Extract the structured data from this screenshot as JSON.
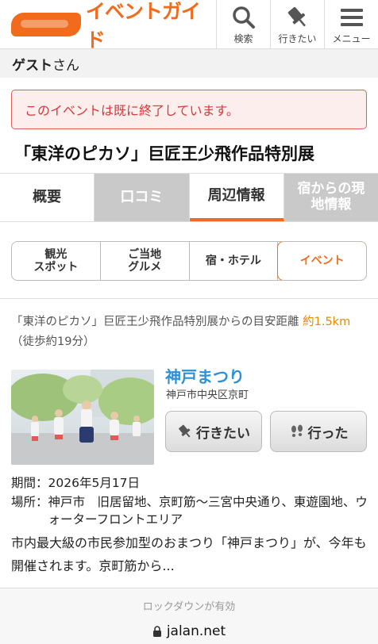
{
  "header": {
    "logo_text": "じゃらん イベントガイド",
    "buttons": [
      {
        "label": "検索",
        "icon": "search-icon"
      },
      {
        "label": "行きたい",
        "icon": "pin-icon"
      },
      {
        "label": "メニュー",
        "icon": "menu-icon"
      }
    ]
  },
  "guest": {
    "name": "ゲスト",
    "suffix": "さん"
  },
  "notice": "このイベントは既に終了しています。",
  "title": "「東洋のピカソ」巨匠王少飛作品特別展",
  "tabs": [
    {
      "label": "概要",
      "state": "normal"
    },
    {
      "label": "口コミ",
      "state": "disabled"
    },
    {
      "label": "周辺情報",
      "state": "active"
    },
    {
      "label": "宿からの現地情報",
      "state": "disabled"
    }
  ],
  "subtabs": [
    {
      "line1": "観光",
      "line2": "スポット"
    },
    {
      "line1": "ご当地",
      "line2": "グルメ"
    },
    {
      "line1": "宿・ホテル",
      "line2": ""
    },
    {
      "line1": "イベント",
      "line2": ""
    }
  ],
  "distance": {
    "prefix": "「東洋のピカソ」巨匠王少飛作品特別展からの目安距離",
    "value": "約1.5km",
    "walk": "（徒歩約19分）"
  },
  "event": {
    "title": "神戸まつり",
    "address": "神戸市中央区京町",
    "want_label": "行きたい",
    "went_label": "行った",
    "period_key": "期間：",
    "period_val": "2026年5月17日",
    "place_key": "場所：",
    "place_val": "神戸市　旧居留地、京町筋～三宮中央通り、東遊園地、ウォーターフロントエリア",
    "description": "市内最大級の市民参加型のおまつり「神戸まつり」が、今年も開催されます。京町筋から..."
  },
  "browser": {
    "lockdown": "ロックダウンが有効",
    "url": "jalan.net"
  },
  "colors": {
    "accent": "#f26b1d",
    "link": "#2d8fd4",
    "alert": "#d23a3a",
    "highlight": "#e38a00"
  }
}
